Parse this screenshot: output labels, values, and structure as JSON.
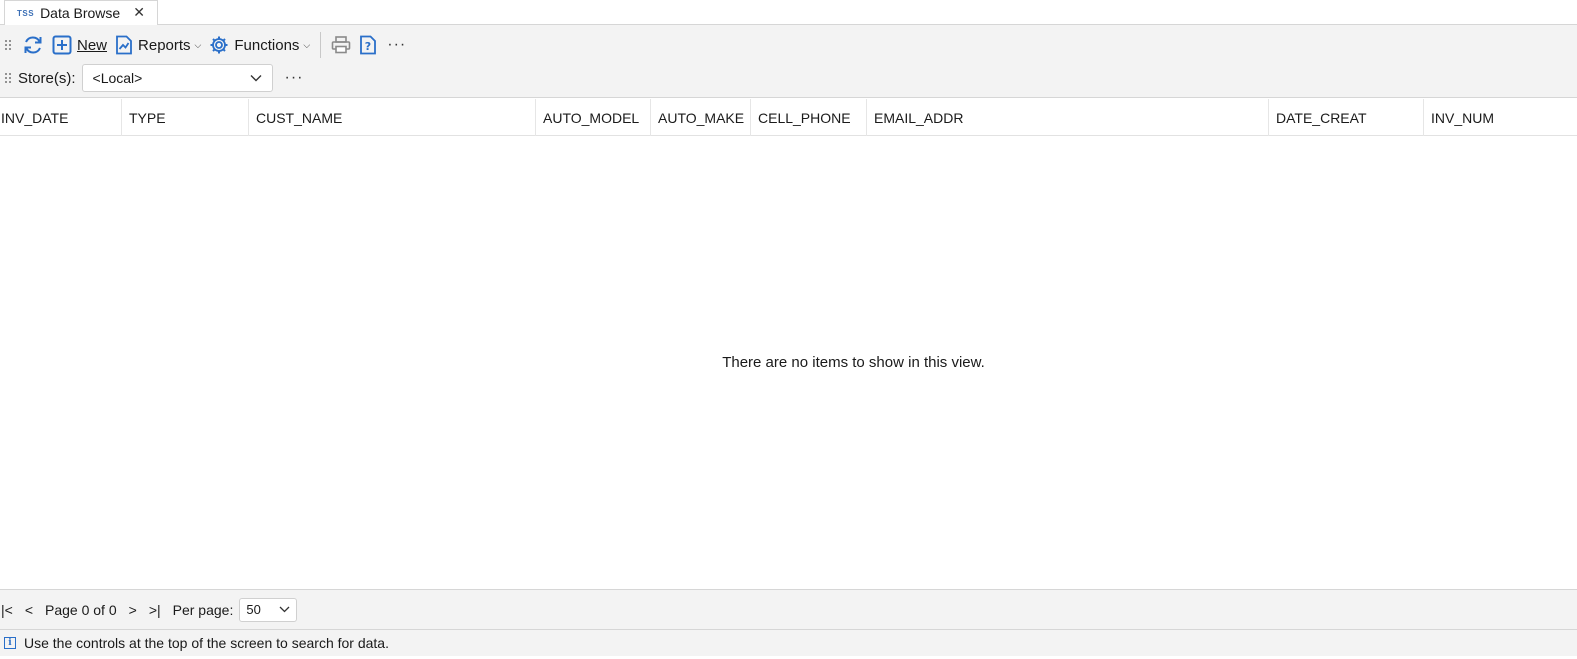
{
  "tab": {
    "icon_text": "TSS",
    "label": "Data Browse",
    "close": "✕"
  },
  "toolbar": {
    "refresh_icon": "refresh-icon",
    "new_label": "New",
    "reports_label": "Reports",
    "functions_label": "Functions",
    "print_icon": "printer-icon",
    "help_icon": "help-document-icon",
    "more": "···"
  },
  "store": {
    "label": "Store(s):",
    "value": "<Local>",
    "more": "···"
  },
  "columns": [
    "INV_DATE",
    "TYPE",
    "CUST_NAME",
    "AUTO_MODEL",
    "AUTO_MAKE",
    "CELL_PHONE",
    "EMAIL_ADDR",
    "DATE_CREAT",
    "INV_NUM"
  ],
  "empty_message": "There are no items to show in this view.",
  "pager": {
    "first": "|<",
    "prev": "<",
    "page_text": "Page 0 of 0",
    "next": ">",
    "last": ">|",
    "per_page_label": "Per page:",
    "per_page_value": "50"
  },
  "status": {
    "icon": "i",
    "message": "Use the controls at the top of the screen to search for data."
  },
  "colors": {
    "accent": "#2a6fc9",
    "toolbar_bg": "#f3f3f3"
  }
}
